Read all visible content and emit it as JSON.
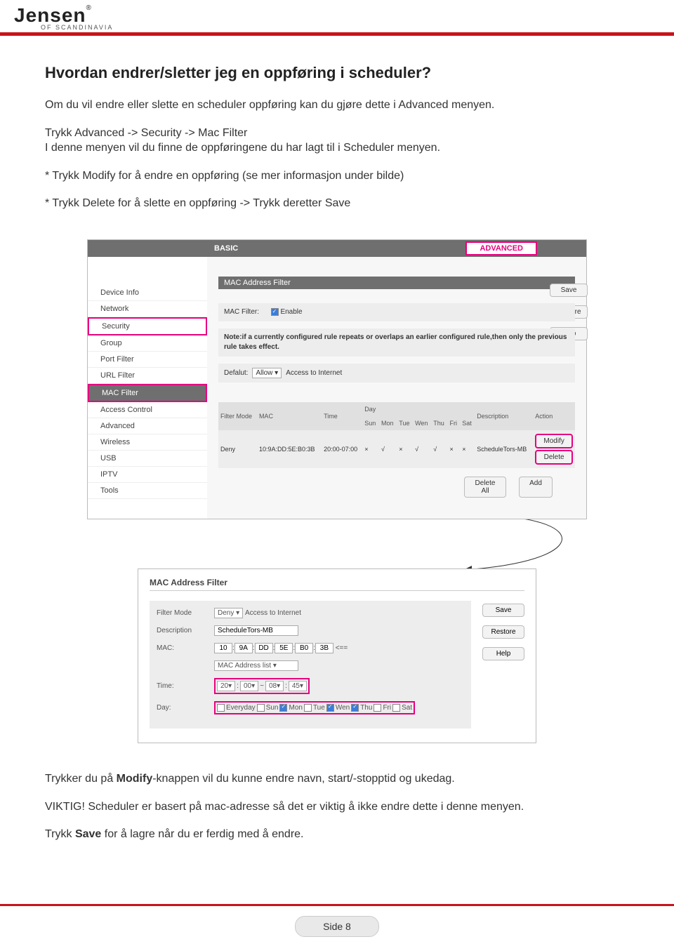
{
  "logo": {
    "brand": "Jensen",
    "reg": "®",
    "tagline": "OF SCANDINAVIA"
  },
  "heading": "Hvordan endrer/sletter jeg en oppføring i scheduler?",
  "paragraphs": {
    "p1": "Om du vil endre eller slette en scheduler oppføring kan du gjøre dette i Advanced menyen.",
    "p2a": "Trykk Advanced -> Security -> Mac Filter",
    "p2b": "I denne menyen vil du finne de oppføringene du har lagt til i Scheduler menyen.",
    "p3": "* Trykk Modify for å endre en oppføring (se mer informasjon under bilde)",
    "p4": "* Trykk Delete for å slette en oppføring -> Trykk deretter Save"
  },
  "shot1": {
    "tab_basic": "BASIC",
    "tab_advanced": "ADVANCED",
    "sidebar": [
      "Device Info",
      "Network",
      "Security",
      "Group",
      "Port Filter",
      "URL Filter",
      "MAC Filter",
      "Access Control",
      "Advanced",
      "Wireless",
      "USB",
      "IPTV",
      "Tools"
    ],
    "panel_title": "MAC Address Filter",
    "mac_filter_label": "MAC Filter:",
    "enable": "Enable",
    "note": "Note:if a currently configured rule repeats or overlaps an earlier configured rule,then only the previous rule takes effect.",
    "default_label": "Defalut:",
    "default_value": "Allow",
    "default_suffix": "Access to Internet",
    "buttons": {
      "save": "Save",
      "restore": "Restore",
      "help": "Help",
      "deleteall": "Delete All",
      "add": "Add"
    },
    "th": {
      "mode": "Filter Mode",
      "mac": "MAC",
      "time": "Time",
      "day": "Day",
      "sun": "Sun",
      "mon": "Mon",
      "tue": "Tue",
      "wen": "Wen",
      "thu": "Thu",
      "fri": "Fri",
      "sat": "Sat",
      "desc": "Description",
      "action": "Action"
    },
    "row": {
      "mode": "Deny",
      "mac": "10:9A:DD:5E:B0:3B",
      "time": "20:00-07:00",
      "sun": "×",
      "mon": "√",
      "tue": "×",
      "wen": "√",
      "thu": "√",
      "fri": "×",
      "sat": "×",
      "desc": "ScheduleTors-MB",
      "modify": "Modify",
      "delete": "Delete"
    }
  },
  "shot2": {
    "panel_title": "MAC Address Filter",
    "labels": {
      "mode": "Filter Mode",
      "desc": "Description",
      "mac": "MAC:",
      "time": "Time:",
      "day": "Day:"
    },
    "mode": "Deny",
    "mode_sfx": "Access to Internet",
    "desc_val": "ScheduleTors-MB",
    "mac": [
      "10",
      "9A",
      "DD",
      "5E",
      "B0",
      "3B"
    ],
    "arrow": "<==",
    "mac_list": "MAC Address list",
    "time": [
      "20",
      "00",
      "08",
      "45"
    ],
    "sep1": ":",
    "sep2": "~",
    "sep3": ":",
    "days": [
      "Everyday",
      "Sun",
      "Mon",
      "Tue",
      "Wen",
      "Thu",
      "Fri",
      "Sat"
    ],
    "checked": {
      "Mon": true,
      "Wen": true,
      "Thu": true
    },
    "buttons": {
      "save": "Save",
      "restore": "Restore",
      "help": "Help"
    }
  },
  "closing": {
    "c1a": "Trykker du på ",
    "c1b": "Modify",
    "c1c": "-knappen vil du kunne endre navn, start/-stopptid og ukedag.",
    "c2": "VIKTIG! Scheduler er basert på mac-adresse så det er viktig å ikke endre dette i denne menyen.",
    "c3a": "Trykk ",
    "c3b": "Save",
    "c3c": " for å lagre når du er ferdig med å endre."
  },
  "page_label": "Side 8"
}
